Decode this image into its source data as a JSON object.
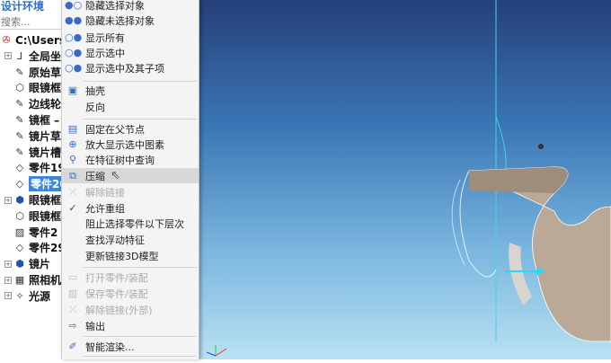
{
  "panel": {
    "title": "设计环境",
    "search_placeholder": "搜索..."
  },
  "tree": [
    {
      "label": "C:\\Users\\",
      "icon": "assembly-icon",
      "expander": "",
      "selected": false
    },
    {
      "label": "全局坐",
      "icon": "axis-icon",
      "expander": "+",
      "selected": false
    },
    {
      "label": "原始草",
      "icon": "sketch-icon",
      "expander": "",
      "selected": false
    },
    {
      "label": "眼镜框",
      "icon": "part-icon",
      "expander": "",
      "selected": false
    },
    {
      "label": "边线轮",
      "icon": "sketch-icon",
      "expander": "",
      "selected": false
    },
    {
      "label": "镜框 –",
      "icon": "sketch-icon",
      "expander": "",
      "selected": false
    },
    {
      "label": "镜片草",
      "icon": "sketch-icon",
      "expander": "",
      "selected": false
    },
    {
      "label": "镜片槽",
      "icon": "sketch-icon",
      "expander": "",
      "selected": false
    },
    {
      "label": "零件19",
      "icon": "surface-icon",
      "expander": "",
      "selected": false
    },
    {
      "label": "零件20",
      "icon": "surface-icon",
      "expander": "",
      "selected": true
    },
    {
      "label": "眼镜框",
      "icon": "solid-icon",
      "expander": "+",
      "selected": false
    },
    {
      "label": "眼镜框",
      "icon": "part-icon",
      "expander": "",
      "selected": false
    },
    {
      "label": "零件2",
      "icon": "image-icon",
      "expander": "",
      "selected": false
    },
    {
      "label": "零件29",
      "icon": "surface-icon",
      "expander": "",
      "selected": false
    },
    {
      "label": "镜片",
      "icon": "solid-icon",
      "expander": "+",
      "selected": false
    },
    {
      "label": "照相机",
      "icon": "camera-icon",
      "expander": "+",
      "selected": false
    },
    {
      "label": "光源",
      "icon": "light-icon",
      "expander": "+",
      "selected": false
    }
  ],
  "menu": [
    {
      "label": "隐藏选择对象",
      "icon": "hide-selected-icon",
      "disabled": false
    },
    {
      "label": "隐藏未选择对象",
      "icon": "hide-unselected-icon",
      "disabled": false
    },
    {
      "label": "显示所有",
      "icon": "show-all-icon",
      "disabled": false
    },
    {
      "label": "显示选中",
      "icon": "show-selected-icon",
      "disabled": false
    },
    {
      "label": "显示选中及其子项",
      "icon": "show-children-icon",
      "disabled": false
    },
    {
      "label": "抽壳",
      "icon": "shell-icon",
      "disabled": false
    },
    {
      "label": "反向",
      "icon": "",
      "disabled": false
    },
    {
      "label": "固定在父节点",
      "icon": "pin-icon",
      "disabled": false
    },
    {
      "label": "放大显示选中图素",
      "icon": "zoom-icon",
      "disabled": false
    },
    {
      "label": "在特征树中查询",
      "icon": "tree-search-icon",
      "disabled": false
    },
    {
      "label": "压缩",
      "icon": "suppress-icon",
      "disabled": false,
      "highlighted": true
    },
    {
      "label": "解除链接",
      "icon": "unlink-icon",
      "disabled": true
    },
    {
      "label": "允许重组",
      "icon": "check-icon",
      "disabled": false
    },
    {
      "label": "阻止选择零件以下层次",
      "icon": "",
      "disabled": false
    },
    {
      "label": "查找浮动特征",
      "icon": "",
      "disabled": false
    },
    {
      "label": "更新链接3D模型",
      "icon": "",
      "disabled": false
    },
    {
      "label": "打开零件/装配",
      "icon": "open-folder-icon",
      "disabled": true
    },
    {
      "label": "保存零件/装配",
      "icon": "save-icon",
      "disabled": true
    },
    {
      "label": "解除链接(外部)",
      "icon": "unlink-external-icon",
      "disabled": true
    },
    {
      "label": "输出",
      "icon": "export-icon",
      "disabled": false
    },
    {
      "label": "智能渲染...",
      "icon": "brush-icon",
      "disabled": false
    }
  ],
  "colors": {
    "selection": "#3d86d8",
    "accent": "#2a6fc9"
  }
}
